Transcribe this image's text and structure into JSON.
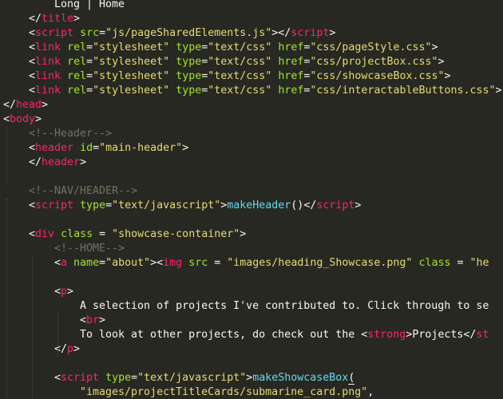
{
  "lines": [
    {
      "indent": 2,
      "segments": [
        {
          "c": "txt",
          "t": "Long | Home"
        }
      ]
    },
    {
      "indent": 1,
      "segments": [
        {
          "c": "punct",
          "t": "</"
        },
        {
          "c": "tag",
          "t": "title"
        },
        {
          "c": "punct",
          "t": ">"
        }
      ]
    },
    {
      "indent": 1,
      "segments": [
        {
          "c": "punct",
          "t": "<"
        },
        {
          "c": "tag",
          "t": "script"
        },
        {
          "c": "txt",
          "t": " "
        },
        {
          "c": "attr",
          "t": "src"
        },
        {
          "c": "punct",
          "t": "="
        },
        {
          "c": "str",
          "t": "\"js/pageSharedElements.js\""
        },
        {
          "c": "punct",
          "t": "></"
        },
        {
          "c": "tag",
          "t": "script"
        },
        {
          "c": "punct",
          "t": ">"
        }
      ]
    },
    {
      "indent": 1,
      "segments": [
        {
          "c": "punct",
          "t": "<"
        },
        {
          "c": "tag",
          "t": "link"
        },
        {
          "c": "txt",
          "t": " "
        },
        {
          "c": "attr",
          "t": "rel"
        },
        {
          "c": "punct",
          "t": "="
        },
        {
          "c": "str",
          "t": "\"stylesheet\""
        },
        {
          "c": "txt",
          "t": " "
        },
        {
          "c": "attr",
          "t": "type"
        },
        {
          "c": "punct",
          "t": "="
        },
        {
          "c": "str",
          "t": "\"text/css\""
        },
        {
          "c": "txt",
          "t": " "
        },
        {
          "c": "attr",
          "t": "href"
        },
        {
          "c": "punct",
          "t": "="
        },
        {
          "c": "str",
          "t": "\"css/pageStyle.css\""
        },
        {
          "c": "punct",
          "t": ">"
        }
      ]
    },
    {
      "indent": 1,
      "segments": [
        {
          "c": "punct",
          "t": "<"
        },
        {
          "c": "tag",
          "t": "link"
        },
        {
          "c": "txt",
          "t": " "
        },
        {
          "c": "attr",
          "t": "rel"
        },
        {
          "c": "punct",
          "t": "="
        },
        {
          "c": "str",
          "t": "\"stylesheet\""
        },
        {
          "c": "txt",
          "t": " "
        },
        {
          "c": "attr",
          "t": "type"
        },
        {
          "c": "punct",
          "t": "="
        },
        {
          "c": "str",
          "t": "\"text/css\""
        },
        {
          "c": "txt",
          "t": " "
        },
        {
          "c": "attr",
          "t": "href"
        },
        {
          "c": "punct",
          "t": "="
        },
        {
          "c": "str",
          "t": "\"css/projectBox.css\""
        },
        {
          "c": "punct",
          "t": ">"
        }
      ]
    },
    {
      "indent": 1,
      "segments": [
        {
          "c": "punct",
          "t": "<"
        },
        {
          "c": "tag",
          "t": "link"
        },
        {
          "c": "txt",
          "t": " "
        },
        {
          "c": "attr",
          "t": "rel"
        },
        {
          "c": "punct",
          "t": "="
        },
        {
          "c": "str",
          "t": "\"stylesheet\""
        },
        {
          "c": "txt",
          "t": " "
        },
        {
          "c": "attr",
          "t": "type"
        },
        {
          "c": "punct",
          "t": "="
        },
        {
          "c": "str",
          "t": "\"text/css\""
        },
        {
          "c": "txt",
          "t": " "
        },
        {
          "c": "attr",
          "t": "href"
        },
        {
          "c": "punct",
          "t": "="
        },
        {
          "c": "str",
          "t": "\"css/showcaseBox.css\""
        },
        {
          "c": "punct",
          "t": ">"
        }
      ]
    },
    {
      "indent": 1,
      "segments": [
        {
          "c": "punct",
          "t": "<"
        },
        {
          "c": "tag",
          "t": "link"
        },
        {
          "c": "txt",
          "t": " "
        },
        {
          "c": "attr",
          "t": "rel"
        },
        {
          "c": "punct",
          "t": "="
        },
        {
          "c": "str",
          "t": "\"stylesheet\""
        },
        {
          "c": "txt",
          "t": " "
        },
        {
          "c": "attr",
          "t": "type"
        },
        {
          "c": "punct",
          "t": "="
        },
        {
          "c": "str",
          "t": "\"text/css\""
        },
        {
          "c": "txt",
          "t": " "
        },
        {
          "c": "attr",
          "t": "href"
        },
        {
          "c": "punct",
          "t": "="
        },
        {
          "c": "str",
          "t": "\"css/interactableButtons.css\""
        },
        {
          "c": "punct",
          "t": ">"
        }
      ]
    },
    {
      "indent": 0,
      "segments": [
        {
          "c": "punct",
          "t": "</"
        },
        {
          "c": "tag",
          "t": "head"
        },
        {
          "c": "punct",
          "t": ">"
        }
      ]
    },
    {
      "indent": 0,
      "segments": [
        {
          "c": "punct",
          "t": "<"
        },
        {
          "c": "tag",
          "t": "body"
        },
        {
          "c": "punct",
          "t": ">"
        }
      ]
    },
    {
      "indent": 1,
      "segments": [
        {
          "c": "cmt",
          "t": "<!--Header-->"
        }
      ]
    },
    {
      "indent": 1,
      "segments": [
        {
          "c": "punct",
          "t": "<"
        },
        {
          "c": "tag",
          "t": "header"
        },
        {
          "c": "txt",
          "t": " "
        },
        {
          "c": "attr",
          "t": "id"
        },
        {
          "c": "punct",
          "t": "="
        },
        {
          "c": "str",
          "t": "\"main-header\""
        },
        {
          "c": "punct",
          "t": ">"
        }
      ]
    },
    {
      "indent": 1,
      "segments": [
        {
          "c": "punct",
          "t": "</"
        },
        {
          "c": "tag",
          "t": "header"
        },
        {
          "c": "punct",
          "t": ">"
        }
      ]
    },
    {
      "indent": 0,
      "segments": []
    },
    {
      "indent": 1,
      "segments": [
        {
          "c": "cmt",
          "t": "<!--NAV/HEADER-->"
        }
      ]
    },
    {
      "indent": 1,
      "segments": [
        {
          "c": "punct",
          "t": "<"
        },
        {
          "c": "tag",
          "t": "script"
        },
        {
          "c": "txt",
          "t": " "
        },
        {
          "c": "attr",
          "t": "type"
        },
        {
          "c": "punct",
          "t": "="
        },
        {
          "c": "str",
          "t": "\"text/javascript\""
        },
        {
          "c": "punct",
          "t": ">"
        },
        {
          "c": "fn",
          "t": "makeHeader"
        },
        {
          "c": "punct",
          "t": "()"
        },
        {
          "c": "punct",
          "t": "</"
        },
        {
          "c": "tag",
          "t": "script"
        },
        {
          "c": "punct",
          "t": ">"
        }
      ]
    },
    {
      "indent": 0,
      "segments": []
    },
    {
      "indent": 1,
      "segments": [
        {
          "c": "punct",
          "t": "<"
        },
        {
          "c": "tag",
          "t": "div"
        },
        {
          "c": "txt",
          "t": " "
        },
        {
          "c": "attr",
          "t": "class"
        },
        {
          "c": "punct",
          "t": " = "
        },
        {
          "c": "str",
          "t": "\"showcase-container\""
        },
        {
          "c": "punct",
          "t": ">"
        }
      ]
    },
    {
      "indent": 2,
      "segments": [
        {
          "c": "cmt",
          "t": "<!--HOME-->"
        }
      ]
    },
    {
      "indent": 2,
      "segments": [
        {
          "c": "punct",
          "t": "<"
        },
        {
          "c": "tag",
          "t": "a"
        },
        {
          "c": "txt",
          "t": " "
        },
        {
          "c": "attr",
          "t": "name"
        },
        {
          "c": "punct",
          "t": "="
        },
        {
          "c": "str",
          "t": "\"about\""
        },
        {
          "c": "punct",
          "t": "><"
        },
        {
          "c": "tag",
          "t": "img"
        },
        {
          "c": "txt",
          "t": " "
        },
        {
          "c": "attr",
          "t": "src"
        },
        {
          "c": "punct",
          "t": " = "
        },
        {
          "c": "str",
          "t": "\"images/heading_Showcase.png\""
        },
        {
          "c": "txt",
          "t": " "
        },
        {
          "c": "attr",
          "t": "class"
        },
        {
          "c": "punct",
          "t": " = "
        },
        {
          "c": "str",
          "t": "\"he"
        }
      ]
    },
    {
      "indent": 0,
      "segments": []
    },
    {
      "indent": 2,
      "segments": [
        {
          "c": "punct",
          "t": "<"
        },
        {
          "c": "tag",
          "t": "p"
        },
        {
          "c": "punct",
          "t": ">"
        }
      ]
    },
    {
      "indent": 3,
      "segments": [
        {
          "c": "txt",
          "t": "A selection of projects I've contributed to. Click through to se"
        }
      ]
    },
    {
      "indent": 3,
      "segments": [
        {
          "c": "punct",
          "t": "<"
        },
        {
          "c": "tag",
          "t": "br"
        },
        {
          "c": "punct",
          "t": ">"
        }
      ]
    },
    {
      "indent": 3,
      "segments": [
        {
          "c": "txt",
          "t": "To look at other projects, do check out the "
        },
        {
          "c": "punct",
          "t": "<"
        },
        {
          "c": "tag",
          "t": "strong"
        },
        {
          "c": "punct",
          "t": ">"
        },
        {
          "c": "txt",
          "t": "Projects"
        },
        {
          "c": "punct",
          "t": "</"
        },
        {
          "c": "tag",
          "t": "st"
        }
      ]
    },
    {
      "indent": 2,
      "segments": [
        {
          "c": "punct",
          "t": "</"
        },
        {
          "c": "tag",
          "t": "p"
        },
        {
          "c": "punct",
          "t": ">"
        }
      ]
    },
    {
      "indent": 0,
      "segments": []
    },
    {
      "indent": 2,
      "segments": [
        {
          "c": "punct",
          "t": "<"
        },
        {
          "c": "tag",
          "t": "script"
        },
        {
          "c": "txt",
          "t": " "
        },
        {
          "c": "attr",
          "t": "type"
        },
        {
          "c": "punct",
          "t": "="
        },
        {
          "c": "str",
          "t": "\"text/javascript\""
        },
        {
          "c": "punct",
          "t": ">"
        },
        {
          "c": "fn",
          "t": "makeShowcaseBox"
        },
        {
          "c": "paren",
          "t": "("
        }
      ]
    },
    {
      "indent": 3,
      "segments": [
        {
          "c": "str",
          "t": "\"images/projectTitleCards/submarine_card.png\""
        },
        {
          "c": "punct",
          "t": ","
        }
      ]
    }
  ]
}
